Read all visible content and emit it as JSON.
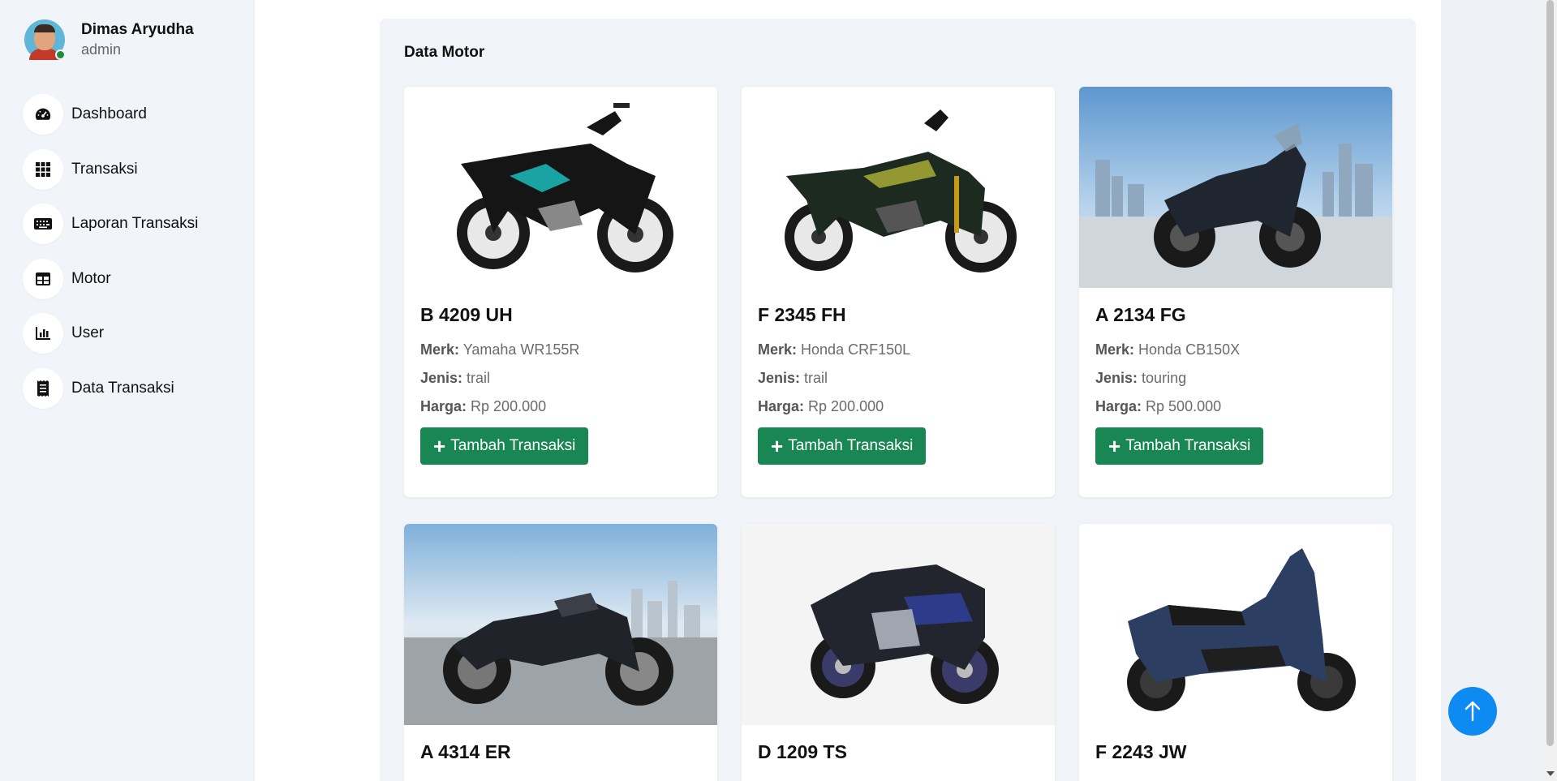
{
  "profile": {
    "name": "Dimas Aryudha",
    "role": "admin"
  },
  "nav": [
    {
      "label": "Dashboard",
      "icon": "gauge-icon"
    },
    {
      "label": "Transaksi",
      "icon": "grid-icon"
    },
    {
      "label": "Laporan Transaksi",
      "icon": "keyboard-icon"
    },
    {
      "label": "Motor",
      "icon": "table-icon"
    },
    {
      "label": "User",
      "icon": "bar-chart-icon"
    },
    {
      "label": "Data Transaksi",
      "icon": "receipt-icon"
    }
  ],
  "section_title": "Data Motor",
  "labels": {
    "merk": "Merk:",
    "jenis": "Jenis:",
    "harga": "Harga:",
    "add_button": "Tambah Transaksi"
  },
  "motors": [
    {
      "plate": "B 4209 UH",
      "merk": "Yamaha WR155R",
      "jenis": "trail",
      "harga": "Rp 200.000"
    },
    {
      "plate": "F 2345 FH",
      "merk": "Honda CRF150L",
      "jenis": "trail",
      "harga": "Rp 200.000"
    },
    {
      "plate": "A 2134 FG",
      "merk": "Honda CB150X",
      "jenis": "touring",
      "harga": "Rp 500.000"
    },
    {
      "plate": "A 4314 ER"
    },
    {
      "plate": "D 1209 TS"
    },
    {
      "plate": "F 2243 JW"
    }
  ],
  "colors": {
    "accent": "#198754",
    "back_to_top": "#0d8bf2"
  }
}
